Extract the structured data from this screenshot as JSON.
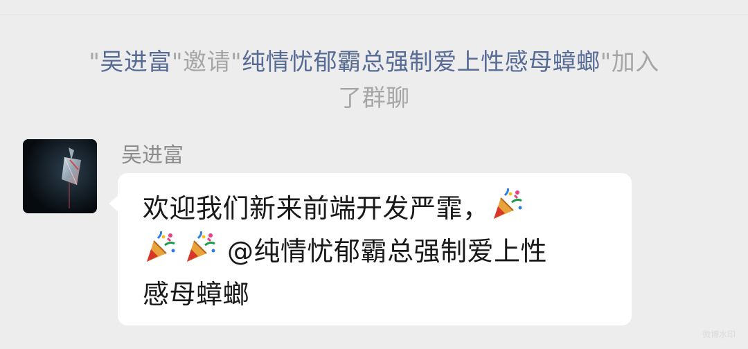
{
  "system_notice": {
    "q1": "\"",
    "inviter": "吴进富",
    "q2": "\"",
    "verb": "邀请",
    "q3": "\"",
    "invitee": "纯情忧郁霸总强制爱上性感母蟑螂",
    "q4": "\"",
    "suffix_line1": "加入",
    "suffix_line2": "了群聊"
  },
  "message": {
    "sender": "吴进富",
    "line1_text": "欢迎我们新来前端开发严霏，",
    "line2_mention": "@纯情忧郁霸总强制爱上性",
    "line3_text": "感母蟑螂",
    "emojis": [
      "party-popper",
      "party-popper",
      "party-popper"
    ]
  },
  "watermark": {
    "text": "微博水印"
  },
  "colors": {
    "background": "#ededed",
    "link": "#576b95",
    "system_text": "#a6a6a6",
    "bubble": "#ffffff",
    "message_text": "#191919"
  }
}
